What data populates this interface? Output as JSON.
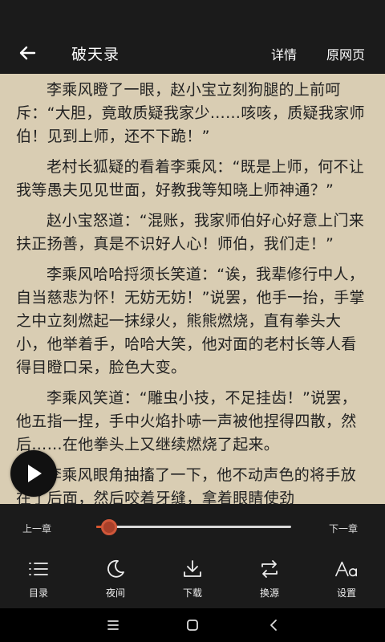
{
  "header": {
    "title": "破天录",
    "details_label": "详情",
    "source_label": "原网页"
  },
  "content": {
    "paragraphs": [
      "李乘风瞪了一眼，赵小宝立刻狗腿的上前呵斥：“大胆，竟敢质疑我家少……咳咳，质疑我家师伯！见到上师，还不下跪！”",
      "老村长狐疑的看着李乘风：“既是上师，何不让我等愚夫见见世面，好教我等知晓上师神通？”",
      "赵小宝怒道：“混账，我家师伯好心好意上门来扶正扬善，真是不识好人心！师伯，我们走！”",
      "李乘风哈哈捋须长笑道：“诶，我辈修行中人，自当慈悲为怀！无妨无妨！”说罢，他手一抬，手掌之中立刻燃起一抹绿火，熊熊燃烧，直有拳头大小，他举着手，哈哈大笑，他对面的老村长等人看得目瞪口呆，脸色大变。",
      "李乘风笑道：“雕虫小技，不足挂齿！”说罢，他五指一捏，手中火焰扑哧一声被他捏得四散，然后……在他拳头上又继续燃烧了起来。",
      "李乘风眼角抽搐了一下，他不动声色的将手放在了后面，然后咬着牙缝，拿着眼睛使劲"
    ]
  },
  "controls": {
    "prev_chapter": "上一章",
    "next_chapter": "下一章",
    "progress_fraction": 0.05,
    "accent_color": "#d9532b",
    "tools": [
      {
        "label": "目录",
        "icon": "list-icon"
      },
      {
        "label": "夜间",
        "icon": "moon-icon"
      },
      {
        "label": "下载",
        "icon": "download-icon"
      },
      {
        "label": "换源",
        "icon": "swap-icon"
      },
      {
        "label": "设置",
        "icon": "font-settings-icon"
      }
    ]
  }
}
